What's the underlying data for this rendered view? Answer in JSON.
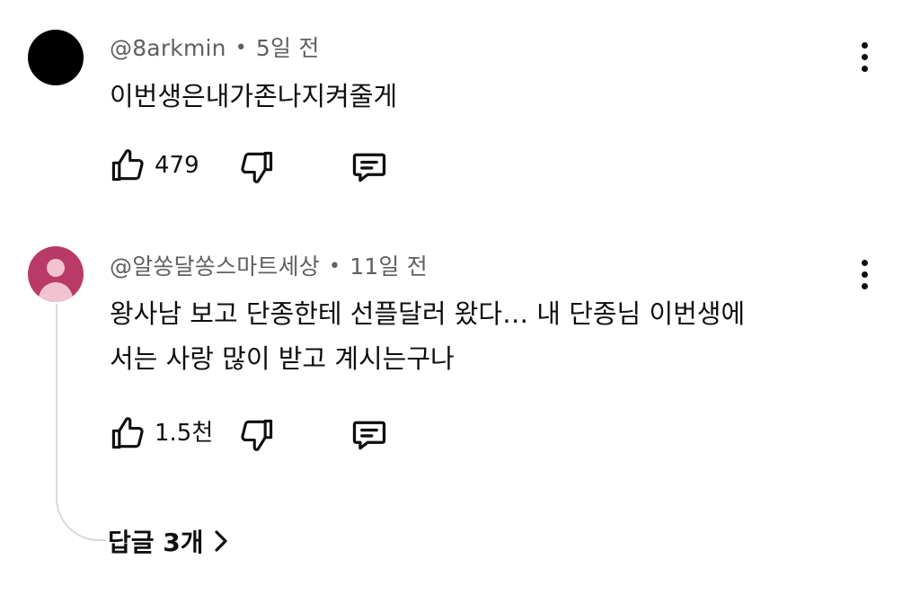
{
  "comments": [
    {
      "author": "@8arkmin",
      "separator": "•",
      "time": "5일 전",
      "text_lines": [
        "이번생은내가존나지켜줄게"
      ],
      "like_count": "479",
      "avatar_color": "#000000",
      "icons": {
        "like": "thumbs-up-icon",
        "dislike": "thumbs-down-icon",
        "reply": "reply-comment-icon",
        "more": "more-vert-icon"
      }
    },
    {
      "author": "@알쏭달쏭스마트세상",
      "separator": "•",
      "time": "11일 전",
      "text_lines": [
        "왕사남 보고 단종한테 선플달러 왔다… 내 단종님 이번생에",
        "서는 사랑 많이 받고 계시는구나"
      ],
      "like_count": "1.5천",
      "avatar_color": "#b93a67",
      "replies_label": "답글 3개",
      "icons": {
        "like": "thumbs-up-icon",
        "dislike": "thumbs-down-icon",
        "reply": "reply-comment-icon",
        "more": "more-vert-icon",
        "replies_chevron": "chevron-right-icon",
        "avatar": "default-user-avatar-icon"
      }
    }
  ],
  "colors": {
    "text_primary": "#0f0f0f",
    "text_secondary": "#606060",
    "thread_line": "#d9d9d9"
  }
}
